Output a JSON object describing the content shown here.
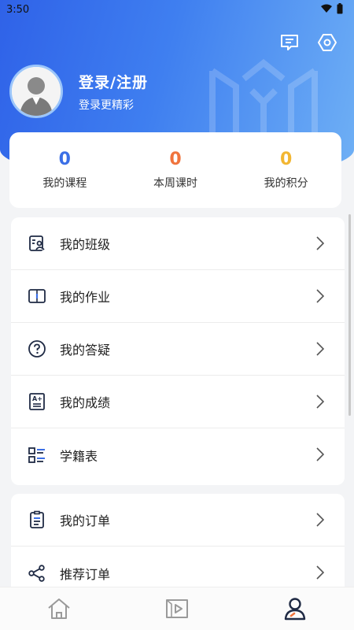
{
  "status_bar": {
    "time": "3:50"
  },
  "header": {
    "login_title": "登录/注册",
    "login_subtitle": "登录更精彩",
    "icons": [
      "message-icon",
      "settings-icon"
    ]
  },
  "stats": [
    {
      "value": "0",
      "label": "我的课程",
      "color": "#3b6fe6"
    },
    {
      "value": "0",
      "label": "本周课时",
      "color": "#f0743d"
    },
    {
      "value": "0",
      "label": "我的积分",
      "color": "#f2b632"
    }
  ],
  "menu_group_1": [
    {
      "label": "我的班级",
      "icon": "class-icon"
    },
    {
      "label": "我的作业",
      "icon": "homework-icon"
    },
    {
      "label": "我的答疑",
      "icon": "question-icon"
    },
    {
      "label": "我的成绩",
      "icon": "grades-icon"
    },
    {
      "label": "学籍表",
      "icon": "list-icon"
    }
  ],
  "menu_group_2": [
    {
      "label": "我的订单",
      "icon": "order-icon"
    },
    {
      "label": "推荐订单",
      "icon": "share-icon"
    }
  ],
  "bottom_nav": [
    {
      "name": "home-icon",
      "active": false
    },
    {
      "name": "video-icon",
      "active": false
    },
    {
      "name": "profile-icon",
      "active": true
    }
  ],
  "colors": {
    "primary": "#2f62e8",
    "accent": "#f0743d",
    "icon": "#1f2a44"
  }
}
